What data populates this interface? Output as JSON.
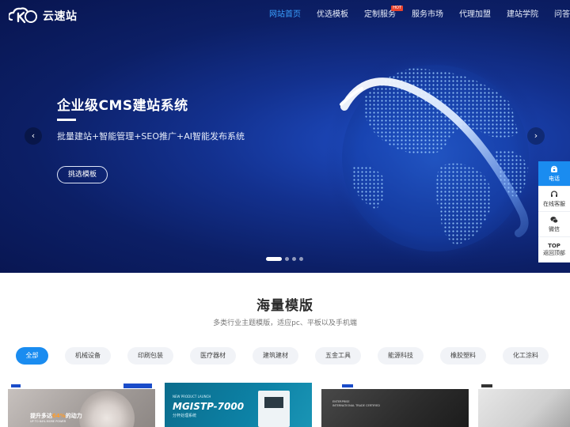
{
  "header": {
    "logo_text": "云速站",
    "nav": [
      {
        "label": "网站首页",
        "active": true
      },
      {
        "label": "优选模板"
      },
      {
        "label": "定制服务",
        "badge": "HOT"
      },
      {
        "label": "服务市场"
      },
      {
        "label": "代理加盟"
      },
      {
        "label": "建站学院"
      },
      {
        "label": "问答中心"
      }
    ]
  },
  "hero": {
    "title": "企业级CMS建站系统",
    "subtitle": "批量建站+智能管理+SEO推广+AI智能发布系统",
    "button": "挑选模板",
    "prev_icon": "chevron-left-icon",
    "next_icon": "chevron-right-icon",
    "prev_glyph": "‹",
    "next_glyph": "›",
    "slides": 4,
    "active_slide": 1
  },
  "float_bar": {
    "items": [
      {
        "label": "电话",
        "icon": "phone-icon"
      },
      {
        "label": "在线客服",
        "icon": "headset-icon"
      },
      {
        "label": "微信",
        "icon": "wechat-icon"
      },
      {
        "label": "返回顶部",
        "icon": "top-icon",
        "top_text": "TOP"
      }
    ]
  },
  "templates": {
    "title": "海量模版",
    "subtitle": "多类行业主题模版，适应pc、平板以及手机端",
    "filters": [
      "全部",
      "机械设备",
      "印刷包装",
      "医疗器材",
      "建筑建材",
      "五金工具",
      "能源科技",
      "橡胶塑料",
      "化工涂料"
    ],
    "active_filter": "全部",
    "thumbs": {
      "t1_headline_pre": "提升多达",
      "t1_headline_hl": "64%",
      "t1_headline_post": "的动力",
      "t1_small": "UP TO 64% MORE POWER",
      "t2_tag": "NEW PRODUCT LAUNCH",
      "t2_model": "MGISTP-7000",
      "t2_desc": "分杯处理系统",
      "t3_line1": "ENTERPRISE",
      "t3_line2": "INTERNATIONAL TRADE CERTIFIED"
    }
  },
  "colors": {
    "accent": "#1a8cf0",
    "hero_bg": "#0c1f66",
    "hot": "#e8432e"
  }
}
